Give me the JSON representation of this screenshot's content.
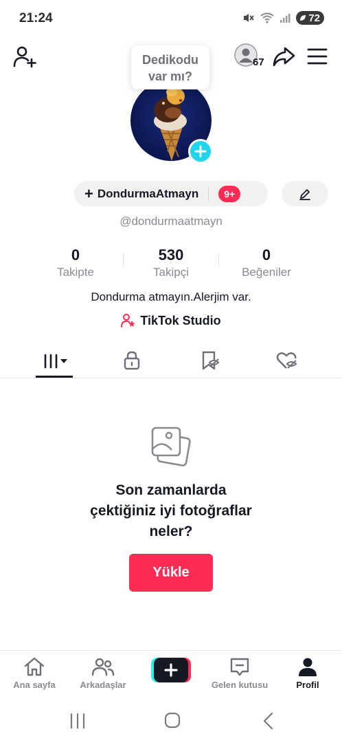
{
  "status_bar": {
    "time": "21:24",
    "battery": "72"
  },
  "header": {
    "viewer_count": "67"
  },
  "bubble": {
    "line1": "Dedikodu",
    "line2": "var mı?"
  },
  "profile": {
    "display_name": "DondurmaAtmayn",
    "notification_badge": "9+",
    "username": "@dondurmaatmayn",
    "bio": "Dondurma atmayın.Alerjim var.",
    "studio_link": "TikTok Studio"
  },
  "stats": [
    {
      "value": "0",
      "label": "Takipte"
    },
    {
      "value": "530",
      "label": "Takipçi"
    },
    {
      "value": "0",
      "label": "Beğeniler"
    }
  ],
  "empty_state": {
    "title_line1": "Son zamanlarda",
    "title_line2": "çektiğiniz iyi fotoğraflar",
    "title_line3": "neler?",
    "button": "Yükle"
  },
  "bottom_nav": {
    "home": "Ana sayfa",
    "friends": "Arkadaşlar",
    "inbox": "Gelen kutusu",
    "profile": "Profil"
  },
  "colors": {
    "accent": "#fe2c55",
    "cyan": "#20d5ec",
    "text": "#161823",
    "muted": "#8a8b91"
  }
}
